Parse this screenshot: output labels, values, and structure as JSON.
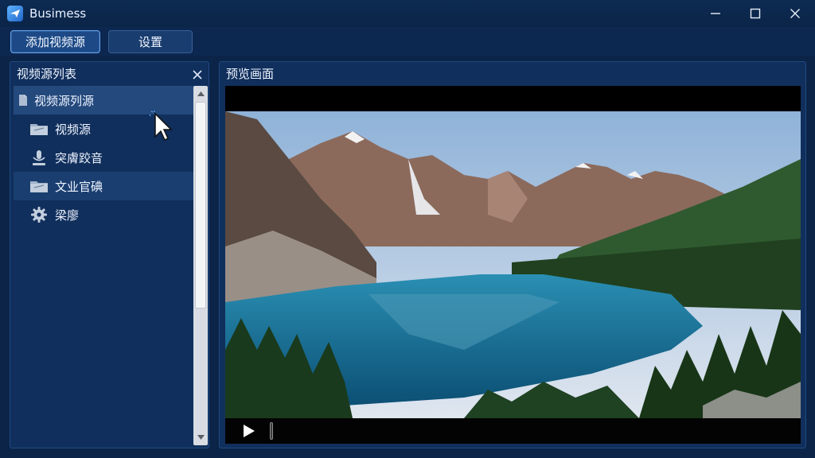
{
  "window": {
    "title": "Busimess",
    "icon": "app-logo-icon",
    "controls": {
      "minimize": "minimize-icon",
      "maximize": "maximize-icon",
      "close": "close-icon"
    }
  },
  "toolbar": {
    "add_source_label": "添加视频源",
    "settings_label": "设置"
  },
  "left_panel": {
    "title": "视频源列表",
    "close": "close-icon",
    "tree": {
      "root": {
        "label": "视频源列源",
        "icon": "document-icon"
      },
      "items": [
        {
          "label": "视频源",
          "icon": "folder-icon"
        },
        {
          "label": "突膚跤音",
          "icon": "microphone-icon"
        },
        {
          "label": "文业官碘",
          "icon": "folder-icon"
        },
        {
          "label": "梁廖",
          "icon": "gear-icon"
        }
      ]
    }
  },
  "right_panel": {
    "title": "预览画面",
    "player": {
      "play_icon": "play-icon",
      "progress": 0
    }
  },
  "colors": {
    "background": "#0b2447",
    "panel": "#112f5c",
    "accent": "#6aa3e6"
  }
}
